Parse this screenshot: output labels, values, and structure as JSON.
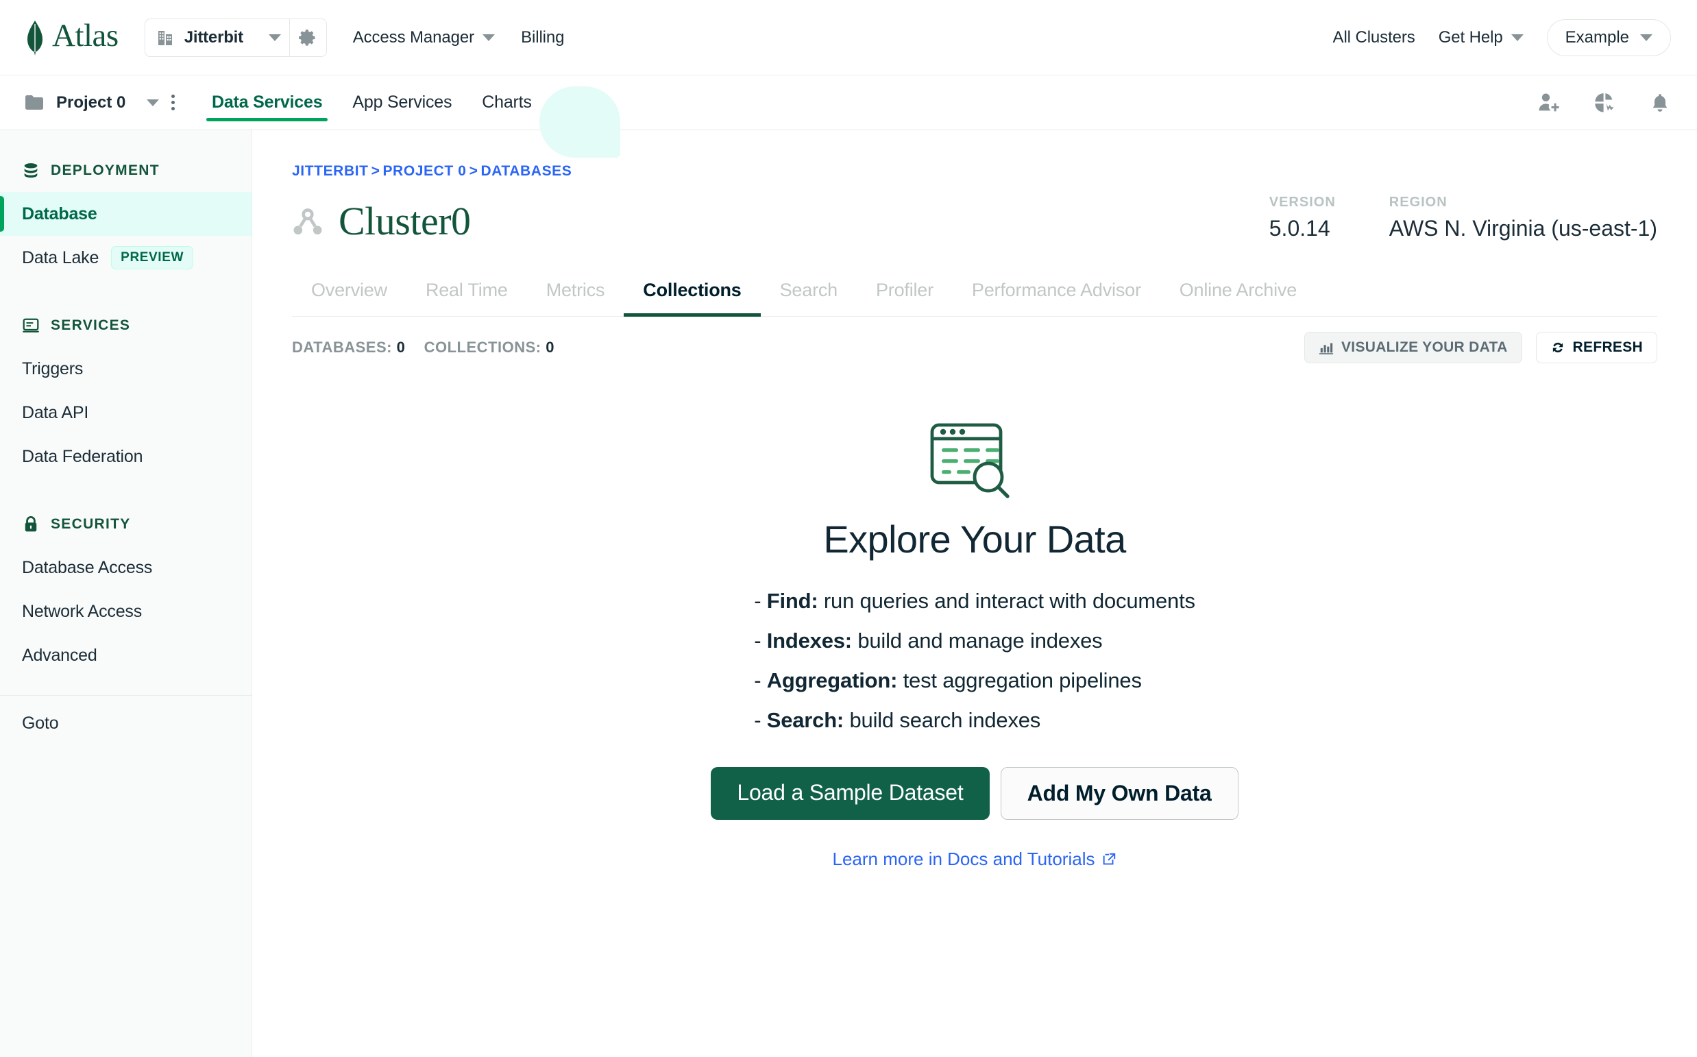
{
  "topnav": {
    "brand": "Atlas",
    "org": {
      "name": "Jitterbit",
      "icon": "building-icon",
      "caret": "chevron-down-icon",
      "gear": "gear-icon"
    },
    "links": [
      {
        "label": "Access Manager",
        "has_caret": true
      },
      {
        "label": "Billing",
        "has_caret": false
      }
    ],
    "all_clusters": "All Clusters",
    "get_help": "Get Help",
    "account": "Example"
  },
  "projectnav": {
    "project": "Project 0",
    "tabs": [
      {
        "label": "Data Services",
        "active": true
      },
      {
        "label": "App Services",
        "active": false
      },
      {
        "label": "Charts",
        "active": false
      }
    ],
    "icons": [
      "invite-user-icon",
      "activity-feed-icon",
      "notification-bell-icon"
    ]
  },
  "sidebar": {
    "groups": [
      {
        "title": "DEPLOYMENT",
        "icon": "database-icon",
        "items": [
          {
            "label": "Database",
            "active": true,
            "badge": null
          },
          {
            "label": "Data Lake",
            "active": false,
            "badge": "PREVIEW"
          }
        ]
      },
      {
        "title": "SERVICES",
        "icon": "services-icon",
        "items": [
          {
            "label": "Triggers",
            "active": false,
            "badge": null
          },
          {
            "label": "Data API",
            "active": false,
            "badge": null
          },
          {
            "label": "Data Federation",
            "active": false,
            "badge": null
          }
        ]
      },
      {
        "title": "SECURITY",
        "icon": "lock-icon",
        "items": [
          {
            "label": "Database Access",
            "active": false,
            "badge": null
          },
          {
            "label": "Network Access",
            "active": false,
            "badge": null
          },
          {
            "label": "Advanced",
            "active": false,
            "badge": null
          }
        ]
      }
    ],
    "footer_item": "Goto"
  },
  "main": {
    "breadcrumb": [
      "JITTERBIT",
      "PROJECT 0",
      "DATABASES"
    ],
    "breadcrumb_separator": ">",
    "cluster_name": "Cluster0",
    "version_label": "VERSION",
    "version_value": "5.0.14",
    "region_label": "REGION",
    "region_value": "AWS N. Virginia (us-east-1)",
    "tabs": [
      {
        "label": "Overview",
        "active": false
      },
      {
        "label": "Real Time",
        "active": false
      },
      {
        "label": "Metrics",
        "active": false
      },
      {
        "label": "Collections",
        "active": true
      },
      {
        "label": "Search",
        "active": false
      },
      {
        "label": "Profiler",
        "active": false
      },
      {
        "label": "Performance Advisor",
        "active": false
      },
      {
        "label": "Online Archive",
        "active": false
      }
    ],
    "counts": {
      "databases_label": "DATABASES:",
      "databases_value": "0",
      "collections_label": "COLLECTIONS:",
      "collections_value": "0"
    },
    "visualize_button": "VISUALIZE YOUR DATA",
    "refresh_button": "REFRESH"
  },
  "empty_state": {
    "illustration": "explore-data-illustration",
    "title": "Explore Your Data",
    "bullets": [
      {
        "dash": "-",
        "term": "Find:",
        "desc": "run queries and interact with documents"
      },
      {
        "dash": "-",
        "term": "Indexes:",
        "desc": "build and manage indexes"
      },
      {
        "dash": "-",
        "term": "Aggregation:",
        "desc": "test aggregation pipelines"
      },
      {
        "dash": "-",
        "term": "Search:",
        "desc": "build search indexes"
      }
    ],
    "primary_button": "Load a Sample Dataset",
    "secondary_button": "Add My Own Data",
    "docs_link": "Learn more in Docs and Tutorials"
  },
  "colors": {
    "brand_green": "#13553a",
    "accent_green": "#00a35c",
    "active_bg": "#e3fcf7",
    "link_blue": "#2b65f5",
    "primary_button": "#116149",
    "muted_gray": "#889397"
  }
}
